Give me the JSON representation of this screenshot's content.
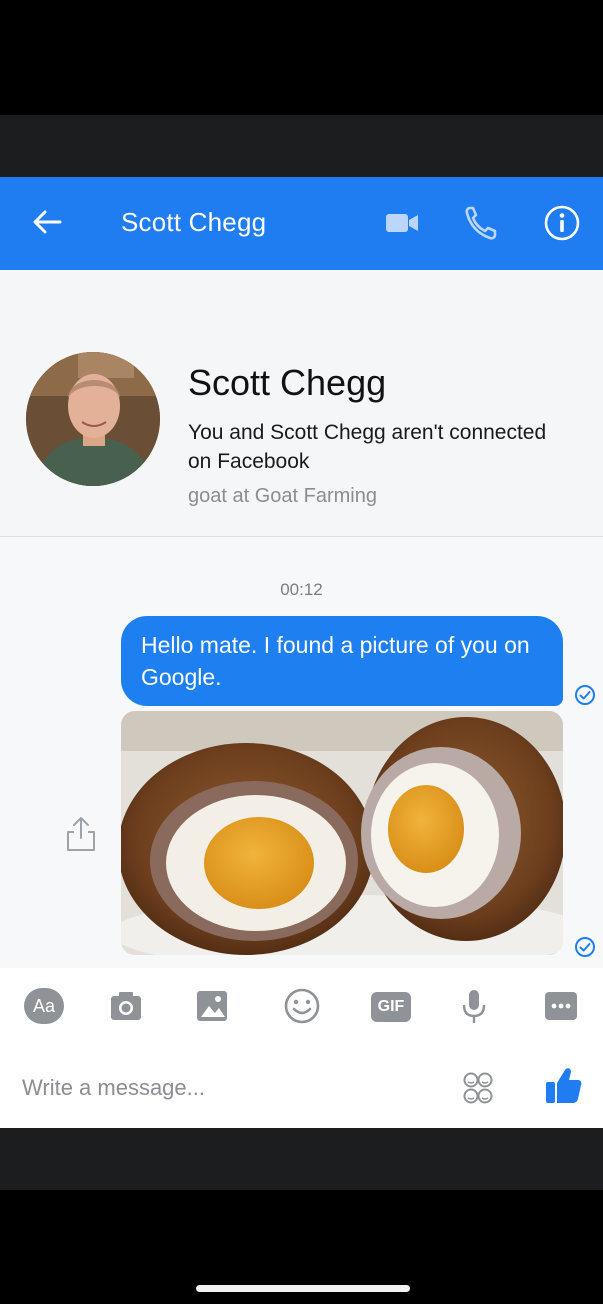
{
  "header": {
    "title": "Scott Chegg",
    "accent_color": "#1f7cf1",
    "icons": [
      "back-arrow-icon",
      "video-call-icon",
      "phone-icon",
      "info-icon"
    ]
  },
  "profile": {
    "name": "Scott Chegg",
    "status": "You and Scott Chegg aren't connected on Facebook",
    "work": "goat at Goat Farming"
  },
  "conversation": {
    "timestamp": "00:12",
    "messages": [
      {
        "type": "text",
        "text": "Hello mate. I found a picture of you on Google.",
        "status_icon": "seen-check-icon"
      },
      {
        "type": "image",
        "depicts": "scotch eggs cut in half",
        "status_icon": "seen-check-icon"
      }
    ]
  },
  "composer": {
    "aa_label": "Aa",
    "gif_label": "GIF",
    "placeholder": "Write a message...",
    "icons": [
      "camera-icon",
      "gallery-icon",
      "emoji-icon",
      "microphone-icon",
      "more-icon",
      "stickers-icon",
      "like-icon"
    ]
  }
}
